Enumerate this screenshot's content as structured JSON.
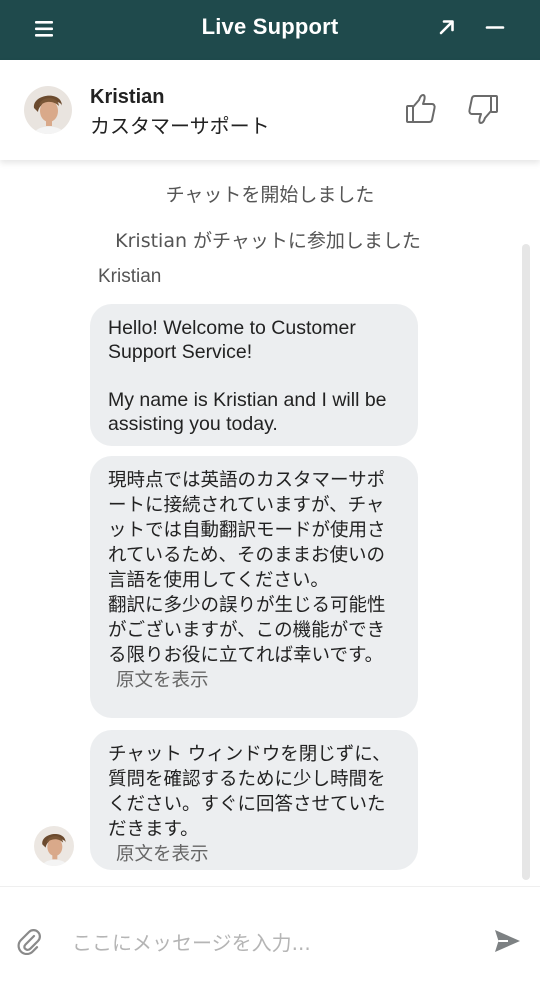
{
  "window": {
    "title": "Live Support",
    "menu_icon": "hamburger-menu-icon",
    "expand_icon": "expand-arrow-icon",
    "minimize_icon": "minimize-icon",
    "bar_color": "#1f4a4c"
  },
  "agent": {
    "name": "Kristian",
    "role": "カスタマーサポート",
    "avatar_icon": "agent-avatar",
    "rate_up_icon": "thumbs-up-icon",
    "rate_down_icon": "thumbs-down-icon"
  },
  "chat": {
    "system_messages": [
      "チャットを開始しました",
      "Kristian がチャットに参加しました"
    ],
    "sender_label": "Kristian",
    "messages": [
      {
        "paragraphs": [
          "Hello! Welcome to Customer Support Service!",
          "My name is Kristian and I will be assisting you today."
        ]
      },
      {
        "text": "現時点では英語のカスタマーサポートに接続されていますが、チャットでは自動翻訳モードが使用されているため、そのままお使いの言語を使用してください。\n翻訳に多少の誤りが生じる可能性がございますが、この機能ができる限りお役に立てれば幸いです。",
        "show_original": "原文を表示"
      },
      {
        "text": "チャット ウィンドウを閉じずに、質問を確認するために少し時間をください。すぐに回答させていただきます。",
        "show_original": "原文を表示"
      }
    ],
    "bubble_color": "#eceef0"
  },
  "composer": {
    "placeholder": "ここにメッセージを入力...",
    "value": "",
    "attach_icon": "paperclip-icon",
    "send_icon": "send-icon"
  }
}
